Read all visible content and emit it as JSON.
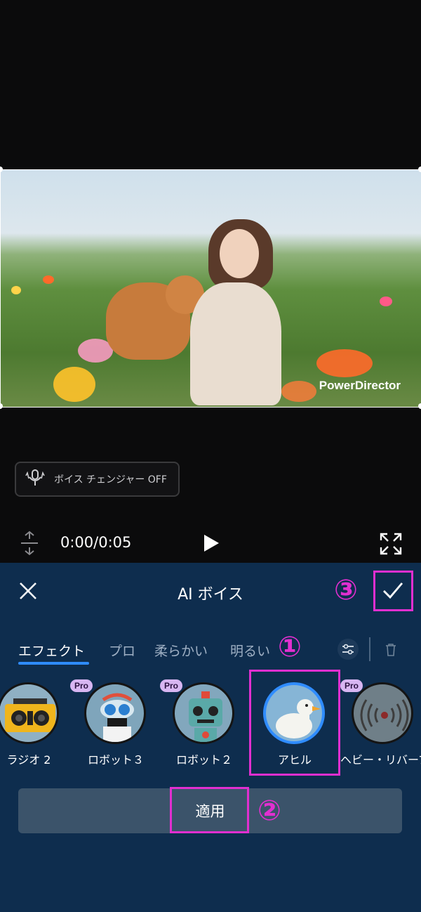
{
  "preview": {
    "watermark": "PowerDirector",
    "voice_changer_label": "ボイス チェンジャー OFF",
    "time": "0:00/0:05"
  },
  "panel": {
    "title": "AI ボイス",
    "tabs": [
      {
        "label": "エフェクト"
      },
      {
        "label": "プロ"
      },
      {
        "label": "柔らかい"
      },
      {
        "label": "明るい"
      }
    ],
    "voices": [
      {
        "label": "ラジオ 2",
        "pro": false
      },
      {
        "label": "ロボット３",
        "pro": true,
        "badge": "Pro"
      },
      {
        "label": "ロボット２",
        "pro": true,
        "badge": "Pro"
      },
      {
        "label": "アヒル",
        "pro": false,
        "selected": true
      },
      {
        "label": "ヘビー・リバーブ",
        "pro": true,
        "badge": "Pro"
      }
    ],
    "apply_label": "適用"
  },
  "annotations": {
    "step1": "①",
    "step2": "②",
    "step3": "③"
  },
  "colors": {
    "panel_bg": "#0e2d4e",
    "accent": "#2f8cff",
    "highlight": "#e12fd0",
    "pro_badge": "#d8b6f2"
  },
  "icons": [
    "mic-wave-icon",
    "split-vertical-icon",
    "play-icon",
    "fullscreen-icon",
    "close-icon",
    "check-icon",
    "sliders-icon",
    "trash-icon"
  ]
}
